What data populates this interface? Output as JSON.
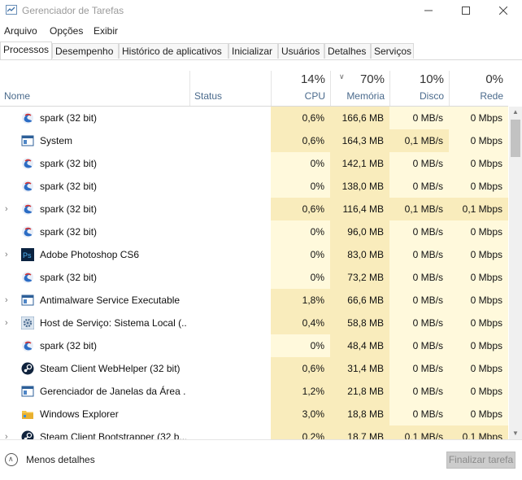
{
  "window": {
    "title": "Gerenciador de Tarefas"
  },
  "menu": [
    "Arquivo",
    "Opções",
    "Exibir"
  ],
  "tabs": [
    "Processos",
    "Desempenho",
    "Histórico de aplicativos",
    "Inicializar",
    "Usuários",
    "Detalhes",
    "Serviços"
  ],
  "active_tab": "Processos",
  "columns": {
    "name": "Nome",
    "status": "Status",
    "cpu": {
      "pct": "14%",
      "label": "CPU"
    },
    "mem": {
      "pct": "70%",
      "label": "Memória"
    },
    "disk": {
      "pct": "10%",
      "label": "Disco"
    },
    "net": {
      "pct": "0%",
      "label": "Rede"
    }
  },
  "processes": [
    {
      "name": "spark (32 bit)",
      "cpu": "0,6%",
      "mem": "166,6 MB",
      "disk": "0 MB/s",
      "net": "0 Mbps",
      "expandable": false,
      "icon": "spark-icon"
    },
    {
      "name": "System",
      "cpu": "0,6%",
      "mem": "164,3 MB",
      "disk": "0,1 MB/s",
      "net": "0 Mbps",
      "expandable": false,
      "icon": "system-icon"
    },
    {
      "name": "spark (32 bit)",
      "cpu": "0%",
      "mem": "142,1 MB",
      "disk": "0 MB/s",
      "net": "0 Mbps",
      "expandable": false,
      "icon": "spark-icon"
    },
    {
      "name": "spark (32 bit)",
      "cpu": "0%",
      "mem": "138,0 MB",
      "disk": "0 MB/s",
      "net": "0 Mbps",
      "expandable": false,
      "icon": "spark-icon"
    },
    {
      "name": "spark (32 bit)",
      "cpu": "0,6%",
      "mem": "116,4 MB",
      "disk": "0,1 MB/s",
      "net": "0,1 Mbps",
      "expandable": true,
      "icon": "spark-icon"
    },
    {
      "name": "spark (32 bit)",
      "cpu": "0%",
      "mem": "96,0 MB",
      "disk": "0 MB/s",
      "net": "0 Mbps",
      "expandable": false,
      "icon": "spark-icon"
    },
    {
      "name": "Adobe Photoshop CS6",
      "cpu": "0%",
      "mem": "83,0 MB",
      "disk": "0 MB/s",
      "net": "0 Mbps",
      "expandable": true,
      "icon": "photoshop-icon"
    },
    {
      "name": "spark (32 bit)",
      "cpu": "0%",
      "mem": "73,2 MB",
      "disk": "0 MB/s",
      "net": "0 Mbps",
      "expandable": false,
      "icon": "spark-icon"
    },
    {
      "name": "Antimalware Service Executable",
      "cpu": "1,8%",
      "mem": "66,6 MB",
      "disk": "0 MB/s",
      "net": "0 Mbps",
      "expandable": true,
      "icon": "system-icon"
    },
    {
      "name": "Host de Serviço: Sistema Local (...",
      "cpu": "0,4%",
      "mem": "58,8 MB",
      "disk": "0 MB/s",
      "net": "0 Mbps",
      "expandable": true,
      "icon": "gear-icon"
    },
    {
      "name": "spark (32 bit)",
      "cpu": "0%",
      "mem": "48,4 MB",
      "disk": "0 MB/s",
      "net": "0 Mbps",
      "expandable": false,
      "icon": "spark-icon"
    },
    {
      "name": "Steam Client WebHelper (32 bit)",
      "cpu": "0,6%",
      "mem": "31,4 MB",
      "disk": "0 MB/s",
      "net": "0 Mbps",
      "expandable": false,
      "icon": "steam-icon"
    },
    {
      "name": "Gerenciador de Janelas da Área ...",
      "cpu": "1,2%",
      "mem": "21,8 MB",
      "disk": "0 MB/s",
      "net": "0 Mbps",
      "expandable": false,
      "icon": "system-icon"
    },
    {
      "name": "Windows Explorer",
      "cpu": "3,0%",
      "mem": "18,8 MB",
      "disk": "0 MB/s",
      "net": "0 Mbps",
      "expandable": false,
      "icon": "folder-icon"
    },
    {
      "name": "Steam Client Bootstrapper (32 b...",
      "cpu": "0,2%",
      "mem": "18,7 MB",
      "disk": "0,1 MB/s",
      "net": "0,1 Mbps",
      "expandable": true,
      "icon": "steam-icon"
    }
  ],
  "footer": {
    "less_details": "Menos detalhes",
    "end_task": "Finalizar tarefa"
  }
}
